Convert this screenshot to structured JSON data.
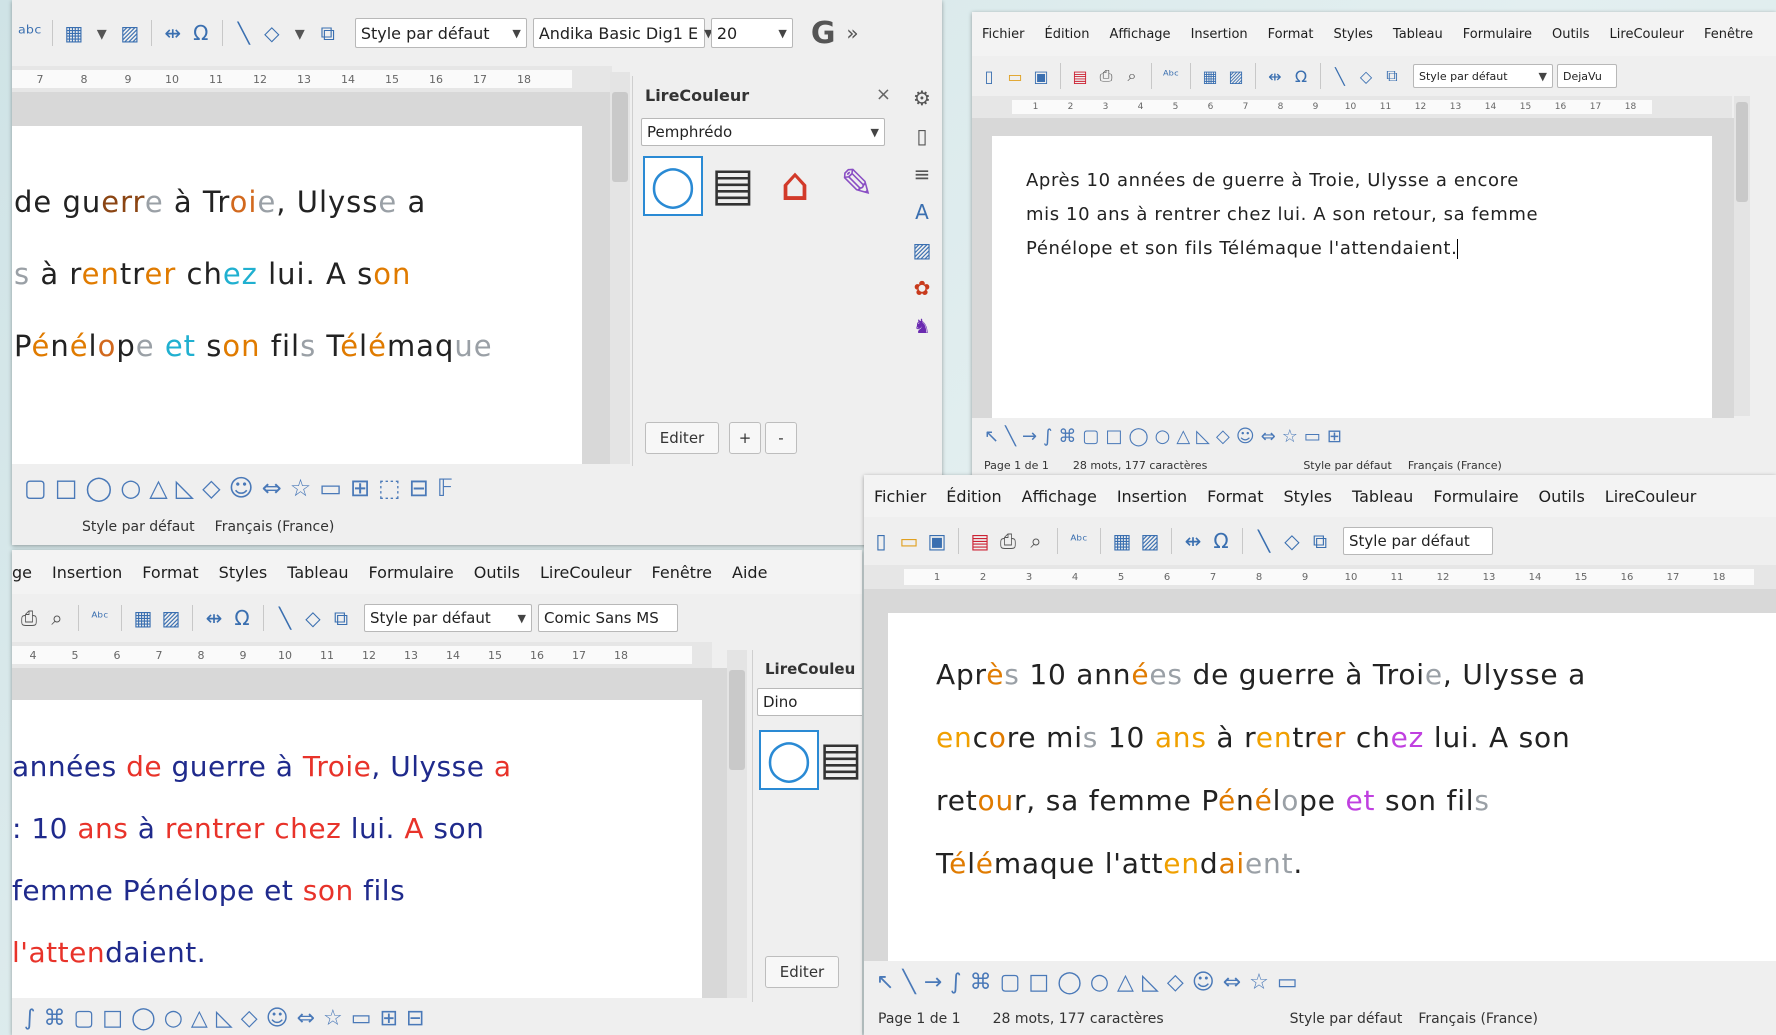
{
  "menu": [
    "Fichier",
    "Édition",
    "Affichage",
    "Insertion",
    "Format",
    "Styles",
    "Tableau",
    "Formulaire",
    "Outils",
    "LireCouleur",
    "Fenêtre",
    "Aide"
  ],
  "windows": {
    "topleft": {
      "style_combo": "Style par défaut",
      "font_combo": "Andika Basic Dig1 E",
      "size_combo": "20",
      "ruler_numbers": [
        "7",
        "8",
        "9",
        "10",
        "11",
        "12",
        "13",
        "14",
        "15",
        "16",
        "17",
        "18"
      ],
      "lines": [
        [
          [
            "de ",
            "#222"
          ],
          [
            "gu",
            "#222"
          ],
          [
            "err",
            "#8b4513"
          ],
          [
            "e",
            "#9aa0a6"
          ],
          [
            " à ",
            "#222"
          ],
          [
            "Tr",
            "#222"
          ],
          [
            "oi",
            "#d2691e"
          ],
          [
            "e",
            "#9aa0a6"
          ],
          [
            ", Ulyss",
            "#222"
          ],
          [
            "e",
            "#9aa0a6"
          ],
          [
            " a",
            "#222"
          ]
        ],
        [
          [
            "s",
            "#9aa0a6"
          ],
          [
            " à ",
            "#222"
          ],
          [
            "r",
            "#222"
          ],
          [
            "en",
            "#e07b00"
          ],
          [
            "tr",
            "#222"
          ],
          [
            "er",
            "#e07b00"
          ],
          [
            " ch",
            "#222"
          ],
          [
            "ez",
            "#20b0d0"
          ],
          [
            " lui. A ",
            "#222"
          ],
          [
            "s",
            "#222"
          ],
          [
            "on",
            "#e07b00"
          ]
        ],
        [
          [
            "P",
            "#222"
          ],
          [
            "é",
            "#e07b00"
          ],
          [
            "n",
            "#222"
          ],
          [
            "é",
            "#e07b00"
          ],
          [
            "l",
            "#222"
          ],
          [
            "o",
            "#d2691e"
          ],
          [
            "p",
            "#222"
          ],
          [
            "e",
            "#9aa0a6"
          ],
          [
            " ",
            "#222"
          ],
          [
            "et",
            "#20b0d0"
          ],
          [
            " s",
            "#222"
          ],
          [
            "on",
            "#e07b00"
          ],
          [
            " fil",
            "#222"
          ],
          [
            "s",
            "#9aa0a6"
          ],
          [
            " T",
            "#222"
          ],
          [
            "é",
            "#e07b00"
          ],
          [
            "l",
            "#222"
          ],
          [
            "é",
            "#e07b00"
          ],
          [
            "maq",
            "#222"
          ],
          [
            "ue",
            "#9aa0a6"
          ]
        ]
      ],
      "panel": {
        "title": "LireCouleur",
        "profile": "Pemphrédo",
        "edit_button": "Editer",
        "plus_button": "+",
        "minus_button": "-"
      },
      "draw_status": {
        "style": "Style par défaut",
        "lang": "Français (France)"
      }
    },
    "topright": {
      "style_combo": "Style par défaut",
      "font_combo": "DejaVu",
      "ruler_numbers": [
        "1",
        "2",
        "3",
        "4",
        "5",
        "6",
        "7",
        "8",
        "9",
        "10",
        "11",
        "12",
        "13",
        "14",
        "15",
        "16",
        "17",
        "18"
      ],
      "lines": [
        "Après 10 années de guerre à Troie, Ulysse a encore",
        "mis 10 ans à rentrer chez lui. A son retour, sa femme",
        "Pénélope et son fils Télémaque l'attendaient."
      ],
      "status": {
        "page": "Page 1 de 1",
        "words": "28 mots, 177 caractères",
        "style": "Style par défaut",
        "lang": "Français (France)"
      }
    },
    "bottomleft": {
      "menu": [
        "ge",
        "Insertion",
        "Format",
        "Styles",
        "Tableau",
        "Formulaire",
        "Outils",
        "LireCouleur",
        "Fenêtre",
        "Aide"
      ],
      "style_combo": "Style par défaut",
      "font_combo": "Comic Sans MS",
      "ruler_numbers": [
        "4",
        "5",
        "6",
        "7",
        "8",
        "9",
        "10",
        "11",
        "12",
        "13",
        "14",
        "15",
        "16",
        "17",
        "18"
      ],
      "lines": [
        [
          [
            "années ",
            "#1f2a8c"
          ],
          [
            "de ",
            "#e8332a"
          ],
          [
            "guerre ",
            "#1f2a8c"
          ],
          [
            "à ",
            "#1f2a8c"
          ],
          [
            "Troie",
            "#e8332a"
          ],
          [
            ", ",
            "#1f2a8c"
          ],
          [
            "Ulysse ",
            "#1f2a8c"
          ],
          [
            "a",
            "#e8332a"
          ]
        ],
        [
          [
            ": 10 ",
            "#1f2a8c"
          ],
          [
            "ans ",
            "#e8332a"
          ],
          [
            "à ",
            "#1f2a8c"
          ],
          [
            "rentrer ",
            "#e8332a"
          ],
          [
            "chez ",
            "#e8332a"
          ],
          [
            "lui. ",
            "#1f2a8c"
          ],
          [
            "A ",
            "#e8332a"
          ],
          [
            "son",
            "#1f2a8c"
          ]
        ],
        [
          [
            "femme ",
            "#1f2a8c"
          ],
          [
            "Pénélope ",
            "#1f2a8c"
          ],
          [
            "et ",
            "#1f2a8c"
          ],
          [
            "son ",
            "#e8332a"
          ],
          [
            "fils",
            "#1f2a8c"
          ]
        ],
        [
          [
            "l'atten",
            "#e8332a"
          ],
          [
            "daient",
            "#1f2a8c"
          ],
          [
            ".",
            "#1f2a8c"
          ]
        ]
      ],
      "panel": {
        "title": "LireCouleu",
        "profile": "Dino",
        "edit_button": "Editer"
      }
    },
    "bottomright": {
      "style_combo": "Style par défaut",
      "ruler_numbers": [
        "1",
        "2",
        "3",
        "4",
        "5",
        "6",
        "7",
        "8",
        "9",
        "10",
        "11",
        "12",
        "13",
        "14",
        "15",
        "16",
        "17",
        "18"
      ],
      "lines": [
        [
          [
            "Apr",
            "#222"
          ],
          [
            "è",
            "#e07b00"
          ],
          [
            "s",
            "#9aa0a6"
          ],
          [
            " 10 ann",
            "#222"
          ],
          [
            "é",
            "#e07b00"
          ],
          [
            "es",
            "#9aa0a6"
          ],
          [
            " de gu",
            "#222"
          ],
          [
            "e",
            "#222"
          ],
          [
            "rr",
            "#222"
          ],
          [
            "e",
            "#222"
          ],
          [
            " à Tr",
            "#222"
          ],
          [
            "o",
            "#222"
          ],
          [
            "i",
            "#222"
          ],
          [
            "e",
            "#9aa0a6"
          ],
          [
            ", Ulysse a",
            "#222"
          ]
        ],
        [
          [
            "en",
            "#f0a000"
          ],
          [
            "c",
            "#222"
          ],
          [
            "o",
            "#e07b00"
          ],
          [
            "re mi",
            "#222"
          ],
          [
            "s",
            "#9aa0a6"
          ],
          [
            " 10 ",
            "#222"
          ],
          [
            "ans",
            "#f0a000"
          ],
          [
            " à r",
            "#222"
          ],
          [
            "en",
            "#f0a000"
          ],
          [
            "tr",
            "#222"
          ],
          [
            "er",
            "#e07b00"
          ],
          [
            " ch",
            "#222"
          ],
          [
            "ez",
            "#c040e0"
          ],
          [
            " lui. A s",
            "#222"
          ],
          [
            "on",
            "#222"
          ]
        ],
        [
          [
            "ret",
            "#222"
          ],
          [
            "ou",
            "#e07b00"
          ],
          [
            "r, sa femme P",
            "#222"
          ],
          [
            "é",
            "#e07b00"
          ],
          [
            "n",
            "#222"
          ],
          [
            "é",
            "#e07b00"
          ],
          [
            "l",
            "#222"
          ],
          [
            "o",
            "#9aa0a6"
          ],
          [
            "pe ",
            "#222"
          ],
          [
            "et",
            "#c040e0"
          ],
          [
            " son fil",
            "#222"
          ],
          [
            "s",
            "#9aa0a6"
          ]
        ],
        [
          [
            "T",
            "#222"
          ],
          [
            "é",
            "#e07b00"
          ],
          [
            "l",
            "#222"
          ],
          [
            "é",
            "#e07b00"
          ],
          [
            "maque l'att",
            "#222"
          ],
          [
            "en",
            "#f0a000"
          ],
          [
            "d",
            "#222"
          ],
          [
            "ai",
            "#e07b00"
          ],
          [
            "en",
            "#9aa0a6"
          ],
          [
            "t",
            "#9aa0a6"
          ],
          [
            ".",
            "#222"
          ]
        ]
      ],
      "status": {
        "page": "Page 1 de 1",
        "words": "28 mots, 177 caractères",
        "style": "Style par défaut",
        "lang": "Français (France)"
      }
    }
  },
  "colors": {
    "accent_blue": "#3a6fb0",
    "doc_bg": "#d8d8d8",
    "page_bg": "#ffffff",
    "lirecouleur_orange": "#e07b00",
    "lirecouleur_grey": "#9aa0a6"
  }
}
